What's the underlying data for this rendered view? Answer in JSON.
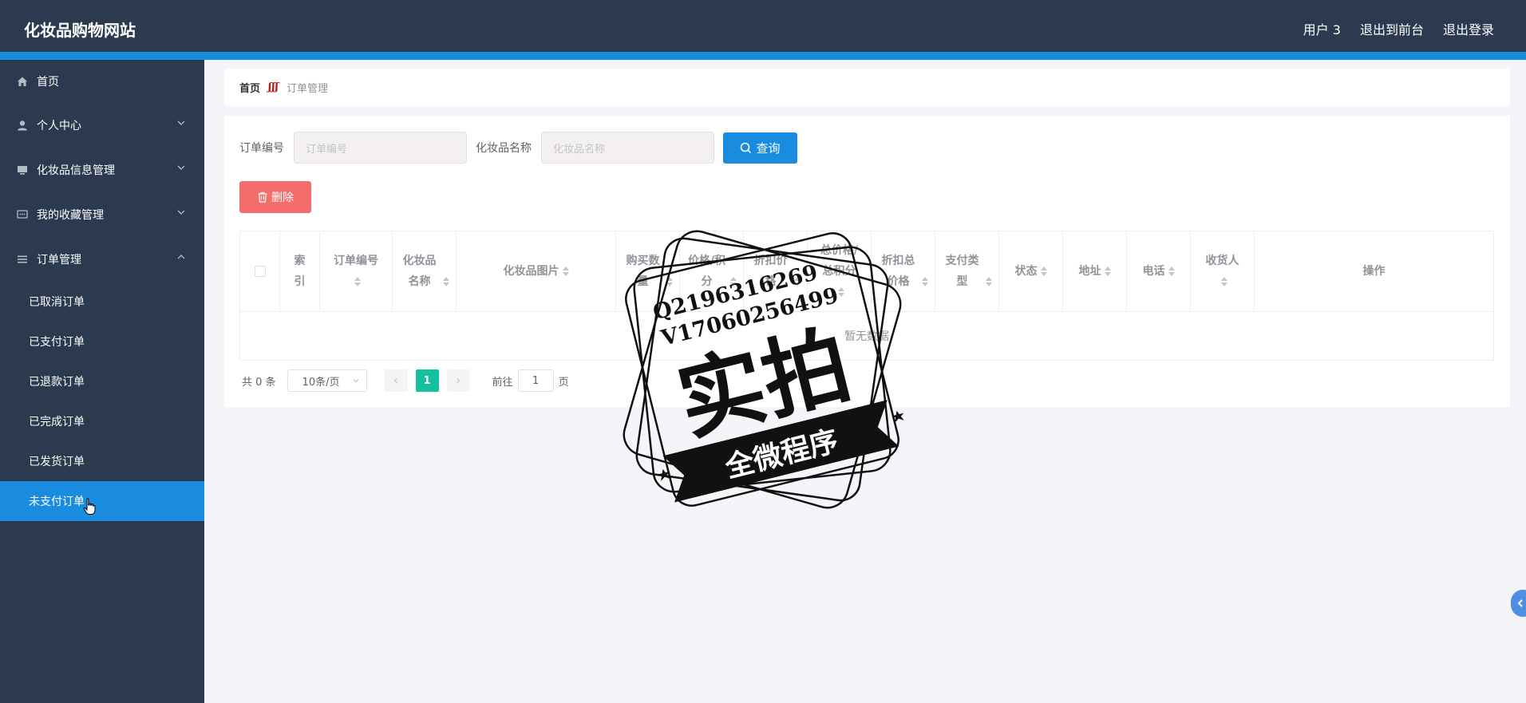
{
  "header": {
    "title": "化妆品购物网站",
    "links": [
      "用户 3",
      "退出到前台",
      "退出登录"
    ],
    "bg_color": "#2c3a4f",
    "accent_color": "#1a8cdf"
  },
  "sidebar": {
    "items": [
      {
        "label": "首页",
        "icon": "home-icon"
      },
      {
        "label": "个人中心",
        "icon": "user-icon",
        "expandable": true
      },
      {
        "label": "化妆品信息管理",
        "icon": "monitor-icon",
        "expandable": true
      },
      {
        "label": "我的收藏管理",
        "icon": "chat-icon",
        "expandable": true
      },
      {
        "label": "订单管理",
        "icon": "menu-icon",
        "expanded": true
      }
    ],
    "sub_items": [
      "已取消订单",
      "已支付订单",
      "已退款订单",
      "已完成订单",
      "已发货订单",
      "未支付订单"
    ],
    "active_sub": "未支付订单"
  },
  "breadcrumb": {
    "home": "首页",
    "current": "订单管理"
  },
  "search": {
    "order_no_label": "订单编号",
    "order_no_placeholder": "订单编号",
    "product_label": "化妆品名称",
    "product_placeholder": "化妆品名称",
    "query_label": "查询"
  },
  "actions": {
    "delete_label": "删除"
  },
  "table": {
    "columns": [
      "索引",
      "订单编号",
      "化妆品名称",
      "化妆品图片",
      "购买数量",
      "价格/积分",
      "折扣价格",
      "总价格/总积分",
      "折扣总价格",
      "支付类型",
      "状态",
      "地址",
      "电话",
      "收货人",
      "操作"
    ],
    "empty_text": "暂无数据"
  },
  "pagination": {
    "total": "共 0 条",
    "page_size": "10条/页",
    "current_page": "1",
    "goto_label": "前往",
    "goto_value": "1",
    "page_unit": "页"
  },
  "watermark": {
    "line1": "Q2196316269",
    "line2": "V17060256499",
    "main": "实拍",
    "banner": "全微程序"
  }
}
